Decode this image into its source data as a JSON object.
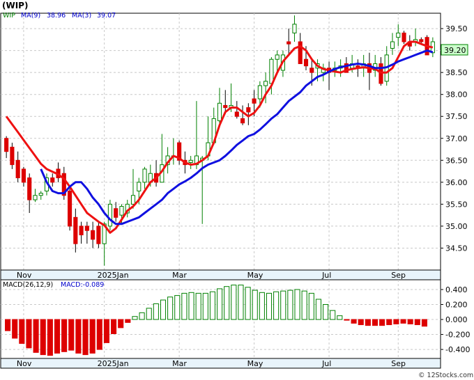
{
  "header": {
    "symbol": "(WIP)",
    "ticker": "WIP",
    "ma9_label": "MA(9)",
    "ma9_value": "38.96",
    "ma3_label": "MA(3)",
    "ma3_value": "39.07"
  },
  "last_price_label": "39.20",
  "macd_header": {
    "params": "MACD(26,12,9)",
    "value": "MACD:-0.089"
  },
  "watermark": "© 12Stocks.com",
  "colors": {
    "up_candle": "#008000",
    "down_candle": "#dd0000",
    "ma9_line": "#1010e0",
    "ma3_line": "#ee1111",
    "price_box": "#ccffcc",
    "axis_band": "#e8f4fb",
    "macd_header_text": "#0000cc"
  },
  "chart_data": [
    {
      "type": "candlestick",
      "ylim": [
        34.0,
        39.85
      ],
      "y_ticks": [
        "34.50",
        "35.00",
        "35.50",
        "36.00",
        "36.50",
        "37.00",
        "37.50",
        "38.00",
        "38.50",
        "39.00",
        "39.50"
      ],
      "x_tick_labels": [
        "Nov",
        "2025Jan",
        "Mar",
        "May",
        "Jul",
        "Sep"
      ],
      "x_tick_positions": [
        3,
        17,
        30,
        43,
        56,
        68
      ],
      "grid": true,
      "candles": [
        [
          37.0,
          37.05,
          36.55,
          36.7
        ],
        [
          36.8,
          36.9,
          36.3,
          36.4
        ],
        [
          36.5,
          36.7,
          36.0,
          36.1
        ],
        [
          36.3,
          36.35,
          35.9,
          36.0
        ],
        [
          36.1,
          36.2,
          35.3,
          35.6
        ],
        [
          35.6,
          35.85,
          35.55,
          35.7
        ],
        [
          35.7,
          35.8,
          35.6,
          35.75
        ],
        [
          35.8,
          36.2,
          35.7,
          36.1
        ],
        [
          36.1,
          36.2,
          35.9,
          36.0
        ],
        [
          36.3,
          36.45,
          36.0,
          36.1
        ],
        [
          36.2,
          36.35,
          35.6,
          35.7
        ],
        [
          35.8,
          35.85,
          34.9,
          35.0
        ],
        [
          35.2,
          35.4,
          34.4,
          34.6
        ],
        [
          35.0,
          35.1,
          34.6,
          34.8
        ],
        [
          35.0,
          35.1,
          34.6,
          34.9
        ],
        [
          34.9,
          35.1,
          34.5,
          34.7
        ],
        [
          35.0,
          35.1,
          34.5,
          34.6
        ],
        [
          34.6,
          35.1,
          34.1,
          35.05
        ],
        [
          35.0,
          35.6,
          34.9,
          35.5
        ],
        [
          35.4,
          35.55,
          35.1,
          35.2
        ],
        [
          35.25,
          35.5,
          35.05,
          35.45
        ],
        [
          35.3,
          35.6,
          35.2,
          35.5
        ],
        [
          35.5,
          36.3,
          35.4,
          35.7
        ],
        [
          35.8,
          36.1,
          35.5,
          36.0
        ],
        [
          36.0,
          36.35,
          35.85,
          36.3
        ],
        [
          36.0,
          36.4,
          35.9,
          36.2
        ],
        [
          36.2,
          36.5,
          35.9,
          36.0
        ],
        [
          36.0,
          37.1,
          36.0,
          36.4
        ],
        [
          36.4,
          36.8,
          36.2,
          36.6
        ],
        [
          36.6,
          37.0,
          36.4,
          36.6
        ],
        [
          36.9,
          36.95,
          36.4,
          36.5
        ],
        [
          36.5,
          36.7,
          36.2,
          36.4
        ],
        [
          36.45,
          36.6,
          36.3,
          36.5
        ],
        [
          36.4,
          37.85,
          36.3,
          36.6
        ],
        [
          36.5,
          36.6,
          35.05,
          36.55
        ],
        [
          36.6,
          37.5,
          36.5,
          36.9
        ],
        [
          36.9,
          37.7,
          36.85,
          37.45
        ],
        [
          37.4,
          38.15,
          37.3,
          37.8
        ],
        [
          37.75,
          38.1,
          37.55,
          37.7
        ],
        [
          37.7,
          38.25,
          37.6,
          37.75
        ],
        [
          37.6,
          37.85,
          37.45,
          37.5
        ],
        [
          37.45,
          37.75,
          37.3,
          37.35
        ],
        [
          37.7,
          37.8,
          37.3,
          37.6
        ],
        [
          37.9,
          38.1,
          37.5,
          37.8
        ],
        [
          37.9,
          38.3,
          37.7,
          38.2
        ],
        [
          38.2,
          38.5,
          37.8,
          38.3
        ],
        [
          38.25,
          38.85,
          38.0,
          38.8
        ],
        [
          38.8,
          39.0,
          38.45,
          38.9
        ],
        [
          38.55,
          39.0,
          38.4,
          38.9
        ],
        [
          39.2,
          39.5,
          38.9,
          39.15
        ],
        [
          39.4,
          39.8,
          39.2,
          39.6
        ],
        [
          39.2,
          39.4,
          38.7,
          38.7
        ],
        [
          38.8,
          39.1,
          38.55,
          38.65
        ],
        [
          38.6,
          38.8,
          38.2,
          38.5
        ],
        [
          38.6,
          38.8,
          38.3,
          38.7
        ],
        [
          38.5,
          38.7,
          38.3,
          38.6
        ],
        [
          38.6,
          38.75,
          38.1,
          38.5
        ],
        [
          38.55,
          38.75,
          38.4,
          38.6
        ],
        [
          38.6,
          38.8,
          38.4,
          38.65
        ],
        [
          38.7,
          38.85,
          38.5,
          38.5
        ],
        [
          38.6,
          38.9,
          38.5,
          38.7
        ],
        [
          38.65,
          38.8,
          38.4,
          38.6
        ],
        [
          38.6,
          38.9,
          38.4,
          38.7
        ],
        [
          38.7,
          38.95,
          38.1,
          38.5
        ],
        [
          38.55,
          38.9,
          38.4,
          38.7
        ],
        [
          38.7,
          38.85,
          38.2,
          38.25
        ],
        [
          38.3,
          39.1,
          38.2,
          38.9
        ],
        [
          39.05,
          39.4,
          38.9,
          39.2
        ],
        [
          39.3,
          39.6,
          39.1,
          39.4
        ],
        [
          39.4,
          39.45,
          39.15,
          39.2
        ],
        [
          39.2,
          39.35,
          39.0,
          39.1
        ],
        [
          39.2,
          39.5,
          39.1,
          39.25
        ],
        [
          39.25,
          39.3,
          39.15,
          39.2
        ],
        [
          39.3,
          39.35,
          38.9,
          38.9
        ],
        [
          38.95,
          39.3,
          38.85,
          39.2
        ]
      ],
      "ma3": [
        37.5,
        37.32,
        37.14,
        36.96,
        36.78,
        36.6,
        36.42,
        36.3,
        36.24,
        36.18,
        36.08,
        35.9,
        35.7,
        35.5,
        35.3,
        35.2,
        35.1,
        35.02,
        34.85,
        34.95,
        35.15,
        35.35,
        35.45,
        35.6,
        35.8,
        36.0,
        36.1,
        36.25,
        36.45,
        36.6,
        36.55,
        36.45,
        36.4,
        36.42,
        36.5,
        36.6,
        36.9,
        37.3,
        37.6,
        37.7,
        37.7,
        37.6,
        37.5,
        37.58,
        37.75,
        38.0,
        38.2,
        38.5,
        38.75,
        38.9,
        39.05,
        39.1,
        39.0,
        38.8,
        38.65,
        38.58,
        38.55,
        38.52,
        38.5,
        38.55,
        38.58,
        38.6,
        38.62,
        38.6,
        38.58,
        38.5,
        38.5,
        38.6,
        38.85,
        39.1,
        39.2,
        39.2,
        39.15,
        39.1,
        39.07
      ],
      "ma9": [
        36.3,
        36.0,
        35.8,
        35.75,
        35.75,
        35.9,
        36.0,
        36.0,
        35.85,
        35.65,
        35.5,
        35.3,
        35.15,
        35.05,
        35.05,
        35.1,
        35.15,
        35.2,
        35.3,
        35.4,
        35.5,
        35.6,
        35.75,
        35.85,
        35.95,
        36.02,
        36.1,
        36.2,
        36.32,
        36.4,
        36.45,
        36.5,
        36.6,
        36.72,
        36.85,
        36.95,
        37.05,
        37.1,
        37.2,
        37.32,
        37.45,
        37.55,
        37.7,
        37.85,
        37.95,
        38.05,
        38.2,
        38.3,
        38.4,
        38.45,
        38.52,
        38.58,
        38.62,
        38.65,
        38.68,
        38.7,
        38.68,
        38.65,
        38.6,
        38.6,
        38.62,
        38.68,
        38.75,
        38.8,
        38.85,
        38.9,
        38.95,
        39.0,
        38.96
      ],
      "ma9_start": 6
    },
    {
      "type": "bar",
      "name": "MACD",
      "ylim": [
        -0.52,
        0.53
      ],
      "y_ticks": [
        "-0.400",
        "-0.200",
        "0.000",
        "0.200",
        "0.400"
      ],
      "x_tick_labels": [
        "Nov",
        "2025Jan",
        "Mar",
        "May",
        "Jul",
        "Sep"
      ],
      "values": [
        -0.15,
        -0.25,
        -0.32,
        -0.38,
        -0.44,
        -0.47,
        -0.48,
        -0.45,
        -0.43,
        -0.41,
        -0.45,
        -0.47,
        -0.45,
        -0.4,
        -0.31,
        -0.19,
        -0.11,
        -0.04,
        0.04,
        0.09,
        0.15,
        0.21,
        0.26,
        0.3,
        0.32,
        0.35,
        0.36,
        0.35,
        0.35,
        0.37,
        0.41,
        0.44,
        0.46,
        0.46,
        0.43,
        0.39,
        0.36,
        0.35,
        0.37,
        0.38,
        0.39,
        0.4,
        0.38,
        0.35,
        0.27,
        0.2,
        0.12,
        0.05,
        -0.01,
        -0.05,
        -0.07,
        -0.08,
        -0.08,
        -0.08,
        -0.07,
        -0.06,
        -0.05,
        -0.06,
        -0.07,
        -0.09
      ]
    }
  ]
}
